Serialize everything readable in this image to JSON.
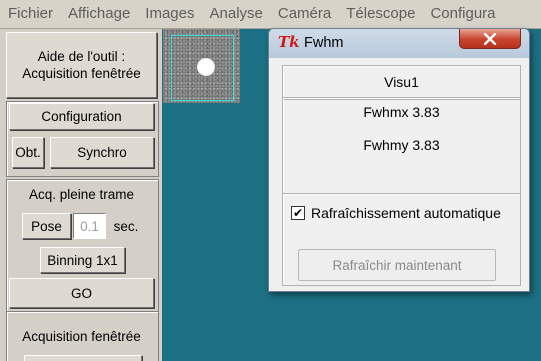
{
  "menubar": {
    "items": [
      "Fichier",
      "Affichage",
      "Images",
      "Analyse",
      "Caméra",
      "Télescope",
      "Configura"
    ]
  },
  "leftpanel": {
    "tool_help": "Aide de l'outil : Acquisition fenêtrée",
    "configuration_label": "Configuration",
    "obt_label": "Obt.",
    "synchro_label": "Synchro",
    "acq_full_frame_title": "Acq. pleine trame",
    "pose_label": "Pose",
    "exposure_value": "0.1",
    "exposure_unit": "sec.",
    "binning_label": "Binning 1x1",
    "go_label": "GO",
    "acq_windowed_title": "Acquisition fenêtrée"
  },
  "fwhm_window": {
    "icon": "tk-feather-icon",
    "title": "Fwhm",
    "close_icon": "close-icon",
    "visu": "Visu1",
    "fwhmx": "Fwhmx 3.83",
    "fwhmy": "Fwhmy 3.83",
    "auto_refresh_checked": true,
    "auto_refresh_label": "Rafraîchissement automatique",
    "refresh_now_label": "Rafraîchir maintenant"
  },
  "colors": {
    "desktop": "#1d6f84",
    "panel": "#d4d0c8",
    "close_button": "#c9442c",
    "selection_box": "#33e0e0"
  }
}
